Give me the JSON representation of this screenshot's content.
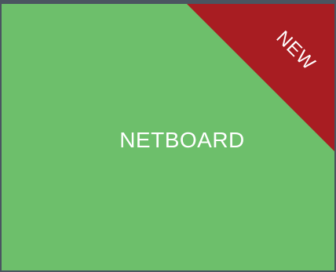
{
  "tile": {
    "label": "NETBOARD",
    "background_color": "#6dbf6b"
  },
  "ribbon": {
    "label": "NEW",
    "color": "#a81d22"
  },
  "page": {
    "background_color": "#4a5560"
  }
}
